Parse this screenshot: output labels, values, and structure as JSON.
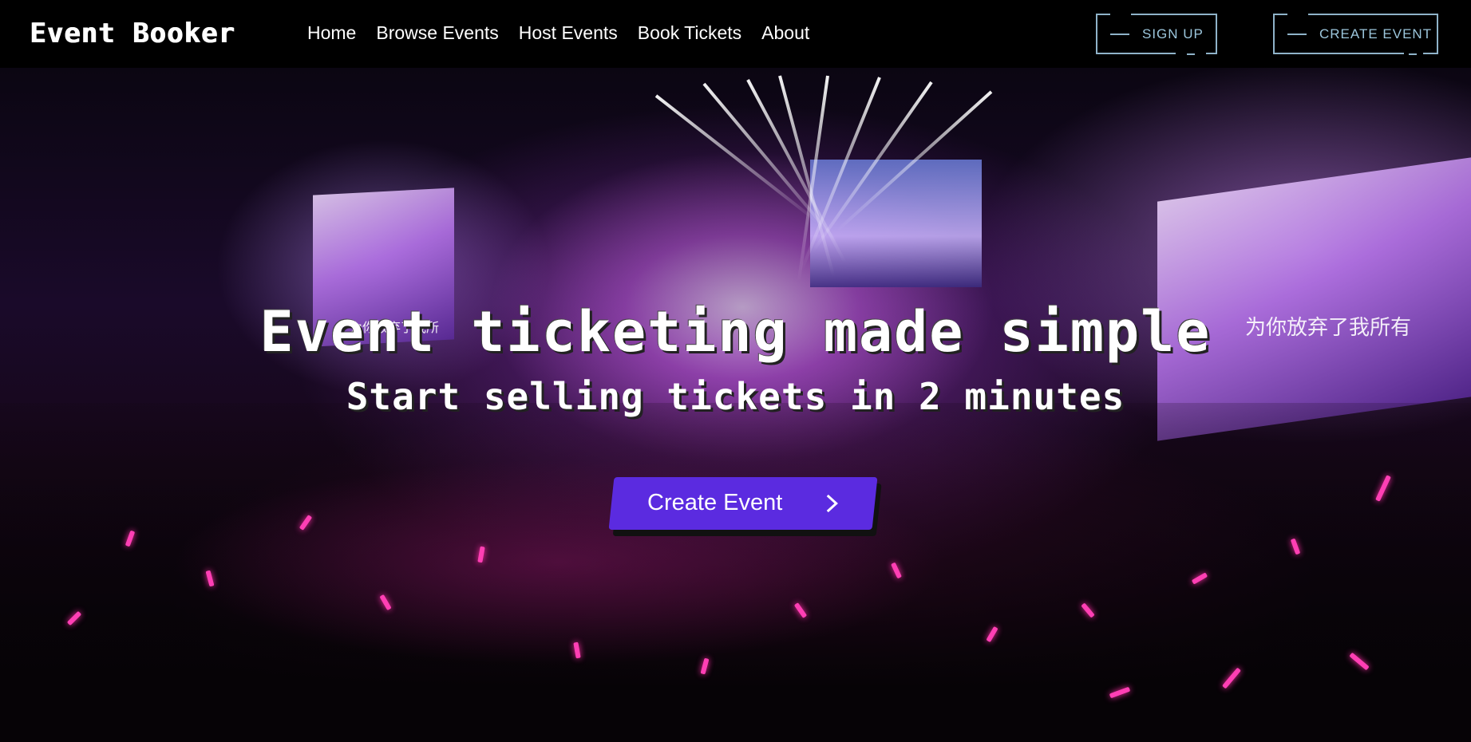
{
  "brand": {
    "logo_text": "Event Booker"
  },
  "nav": {
    "links": [
      "Home",
      "Browse Events",
      "Host Events",
      "Book Tickets",
      "About"
    ],
    "signup_label": "SIGN UP",
    "create_event_label": "CREATE EVENT"
  },
  "hero": {
    "headline": "Event ticketing made simple",
    "subheadline": "Start selling tickets in 2 minutes",
    "cta_label": "Create Event",
    "cta_icon": "chevron-right-icon",
    "screen_text_left": "为你放弃了我所",
    "screen_text_right": "为你放弃了我所有"
  },
  "colors": {
    "nav_bg": "#000000",
    "cta_bg": "#5b2be0",
    "outline_button": "#8fb3c9",
    "text": "#ffffff",
    "glowstick": "#ff3fb4"
  }
}
